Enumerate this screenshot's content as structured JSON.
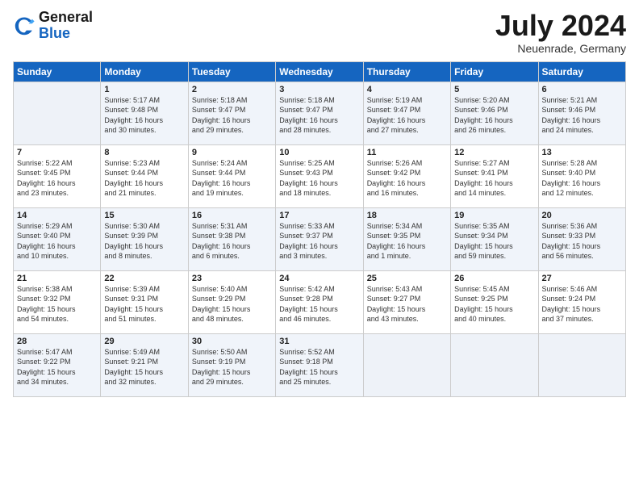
{
  "header": {
    "logo_general": "General",
    "logo_blue": "Blue",
    "month": "July 2024",
    "location": "Neuenrade, Germany"
  },
  "weekdays": [
    "Sunday",
    "Monday",
    "Tuesday",
    "Wednesday",
    "Thursday",
    "Friday",
    "Saturday"
  ],
  "weeks": [
    [
      {
        "num": "",
        "empty": true
      },
      {
        "num": "1",
        "sunrise": "5:17 AM",
        "sunset": "9:48 PM",
        "daylight": "16 hours and 30 minutes."
      },
      {
        "num": "2",
        "sunrise": "5:18 AM",
        "sunset": "9:47 PM",
        "daylight": "16 hours and 29 minutes."
      },
      {
        "num": "3",
        "sunrise": "5:18 AM",
        "sunset": "9:47 PM",
        "daylight": "16 hours and 28 minutes."
      },
      {
        "num": "4",
        "sunrise": "5:19 AM",
        "sunset": "9:47 PM",
        "daylight": "16 hours and 27 minutes."
      },
      {
        "num": "5",
        "sunrise": "5:20 AM",
        "sunset": "9:46 PM",
        "daylight": "16 hours and 26 minutes."
      },
      {
        "num": "6",
        "sunrise": "5:21 AM",
        "sunset": "9:46 PM",
        "daylight": "16 hours and 24 minutes."
      }
    ],
    [
      {
        "num": "7",
        "sunrise": "5:22 AM",
        "sunset": "9:45 PM",
        "daylight": "16 hours and 23 minutes."
      },
      {
        "num": "8",
        "sunrise": "5:23 AM",
        "sunset": "9:44 PM",
        "daylight": "16 hours and 21 minutes."
      },
      {
        "num": "9",
        "sunrise": "5:24 AM",
        "sunset": "9:44 PM",
        "daylight": "16 hours and 19 minutes."
      },
      {
        "num": "10",
        "sunrise": "5:25 AM",
        "sunset": "9:43 PM",
        "daylight": "16 hours and 18 minutes."
      },
      {
        "num": "11",
        "sunrise": "5:26 AM",
        "sunset": "9:42 PM",
        "daylight": "16 hours and 16 minutes."
      },
      {
        "num": "12",
        "sunrise": "5:27 AM",
        "sunset": "9:41 PM",
        "daylight": "16 hours and 14 minutes."
      },
      {
        "num": "13",
        "sunrise": "5:28 AM",
        "sunset": "9:40 PM",
        "daylight": "16 hours and 12 minutes."
      }
    ],
    [
      {
        "num": "14",
        "sunrise": "5:29 AM",
        "sunset": "9:40 PM",
        "daylight": "16 hours and 10 minutes."
      },
      {
        "num": "15",
        "sunrise": "5:30 AM",
        "sunset": "9:39 PM",
        "daylight": "16 hours and 8 minutes."
      },
      {
        "num": "16",
        "sunrise": "5:31 AM",
        "sunset": "9:38 PM",
        "daylight": "16 hours and 6 minutes."
      },
      {
        "num": "17",
        "sunrise": "5:33 AM",
        "sunset": "9:37 PM",
        "daylight": "16 hours and 3 minutes."
      },
      {
        "num": "18",
        "sunrise": "5:34 AM",
        "sunset": "9:35 PM",
        "daylight": "16 hours and 1 minute."
      },
      {
        "num": "19",
        "sunrise": "5:35 AM",
        "sunset": "9:34 PM",
        "daylight": "15 hours and 59 minutes."
      },
      {
        "num": "20",
        "sunrise": "5:36 AM",
        "sunset": "9:33 PM",
        "daylight": "15 hours and 56 minutes."
      }
    ],
    [
      {
        "num": "21",
        "sunrise": "5:38 AM",
        "sunset": "9:32 PM",
        "daylight": "15 hours and 54 minutes."
      },
      {
        "num": "22",
        "sunrise": "5:39 AM",
        "sunset": "9:31 PM",
        "daylight": "15 hours and 51 minutes."
      },
      {
        "num": "23",
        "sunrise": "5:40 AM",
        "sunset": "9:29 PM",
        "daylight": "15 hours and 48 minutes."
      },
      {
        "num": "24",
        "sunrise": "5:42 AM",
        "sunset": "9:28 PM",
        "daylight": "15 hours and 46 minutes."
      },
      {
        "num": "25",
        "sunrise": "5:43 AM",
        "sunset": "9:27 PM",
        "daylight": "15 hours and 43 minutes."
      },
      {
        "num": "26",
        "sunrise": "5:45 AM",
        "sunset": "9:25 PM",
        "daylight": "15 hours and 40 minutes."
      },
      {
        "num": "27",
        "sunrise": "5:46 AM",
        "sunset": "9:24 PM",
        "daylight": "15 hours and 37 minutes."
      }
    ],
    [
      {
        "num": "28",
        "sunrise": "5:47 AM",
        "sunset": "9:22 PM",
        "daylight": "15 hours and 34 minutes."
      },
      {
        "num": "29",
        "sunrise": "5:49 AM",
        "sunset": "9:21 PM",
        "daylight": "15 hours and 32 minutes."
      },
      {
        "num": "30",
        "sunrise": "5:50 AM",
        "sunset": "9:19 PM",
        "daylight": "15 hours and 29 minutes."
      },
      {
        "num": "31",
        "sunrise": "5:52 AM",
        "sunset": "9:18 PM",
        "daylight": "15 hours and 25 minutes."
      },
      {
        "num": "",
        "empty": true
      },
      {
        "num": "",
        "empty": true
      },
      {
        "num": "",
        "empty": true
      }
    ]
  ]
}
